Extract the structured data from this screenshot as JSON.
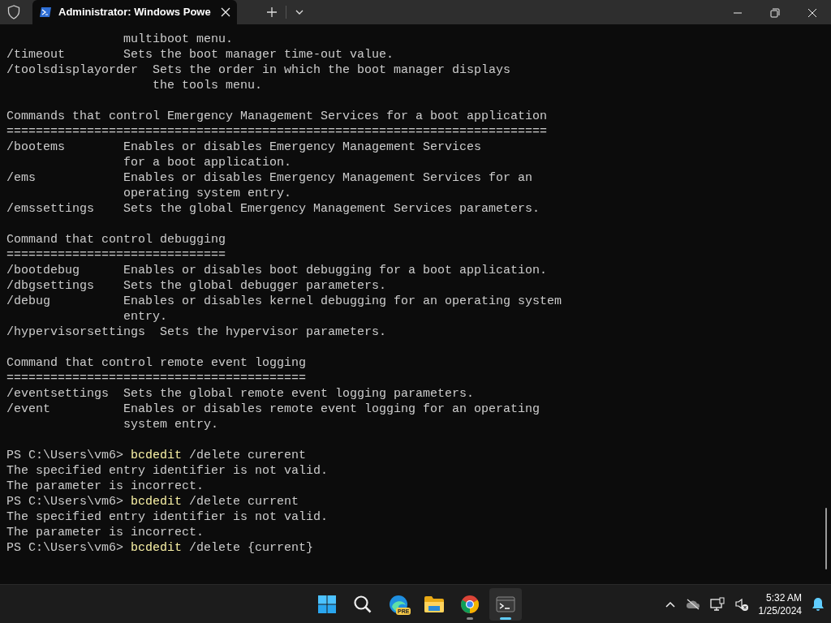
{
  "window": {
    "tab": {
      "title": "Administrator: Windows Powe",
      "selected": true
    }
  },
  "terminal": {
    "lines": [
      {
        "kind": "output",
        "text": "                multiboot menu."
      },
      {
        "kind": "output",
        "text": "/timeout        Sets the boot manager time-out value."
      },
      {
        "kind": "output",
        "text": "/toolsdisplayorder  Sets the order in which the boot manager displays"
      },
      {
        "kind": "output",
        "text": "                    the tools menu."
      },
      {
        "kind": "blank"
      },
      {
        "kind": "output",
        "text": "Commands that control Emergency Management Services for a boot application"
      },
      {
        "kind": "output",
        "text": "=========================================================================="
      },
      {
        "kind": "output",
        "text": "/bootems        Enables or disables Emergency Management Services"
      },
      {
        "kind": "output",
        "text": "                for a boot application."
      },
      {
        "kind": "output",
        "text": "/ems            Enables or disables Emergency Management Services for an"
      },
      {
        "kind": "output",
        "text": "                operating system entry."
      },
      {
        "kind": "output",
        "text": "/emssettings    Sets the global Emergency Management Services parameters."
      },
      {
        "kind": "blank"
      },
      {
        "kind": "output",
        "text": "Command that control debugging"
      },
      {
        "kind": "output",
        "text": "=============================="
      },
      {
        "kind": "output",
        "text": "/bootdebug      Enables or disables boot debugging for a boot application."
      },
      {
        "kind": "output",
        "text": "/dbgsettings    Sets the global debugger parameters."
      },
      {
        "kind": "output",
        "text": "/debug          Enables or disables kernel debugging for an operating system"
      },
      {
        "kind": "output",
        "text": "                entry."
      },
      {
        "kind": "output",
        "text": "/hypervisorsettings  Sets the hypervisor parameters."
      },
      {
        "kind": "blank"
      },
      {
        "kind": "output",
        "text": "Command that control remote event logging"
      },
      {
        "kind": "output",
        "text": "========================================="
      },
      {
        "kind": "output",
        "text": "/eventsettings  Sets the global remote event logging parameters."
      },
      {
        "kind": "output",
        "text": "/event          Enables or disables remote event logging for an operating"
      },
      {
        "kind": "output",
        "text": "                system entry."
      },
      {
        "kind": "blank"
      },
      {
        "kind": "prompt",
        "prompt": "PS C:\\Users\\vm6>",
        "command": "bcdedit",
        "args": "/delete curerent"
      },
      {
        "kind": "output",
        "text": "The specified entry identifier is not valid."
      },
      {
        "kind": "output",
        "text": "The parameter is incorrect."
      },
      {
        "kind": "prompt",
        "prompt": "PS C:\\Users\\vm6>",
        "command": "bcdedit",
        "args": "/delete current"
      },
      {
        "kind": "output",
        "text": "The specified entry identifier is not valid."
      },
      {
        "kind": "output",
        "text": "The parameter is incorrect."
      },
      {
        "kind": "prompt",
        "prompt": "PS C:\\Users\\vm6>",
        "command": "bcdedit",
        "args": "/delete {current}"
      }
    ]
  },
  "taskbar": {
    "apps": [
      {
        "kind": "start",
        "running": false,
        "selected": false
      },
      {
        "kind": "search",
        "running": false,
        "selected": false
      },
      {
        "kind": "edge",
        "badge": "PRE",
        "running": false,
        "selected": false
      },
      {
        "kind": "folder",
        "running": false,
        "selected": false
      },
      {
        "kind": "chrome",
        "running": true,
        "selected": false
      },
      {
        "kind": "terminal",
        "running": true,
        "selected": true
      }
    ],
    "clock": {
      "time": "5:32 AM",
      "date": "1/25/2024"
    }
  }
}
